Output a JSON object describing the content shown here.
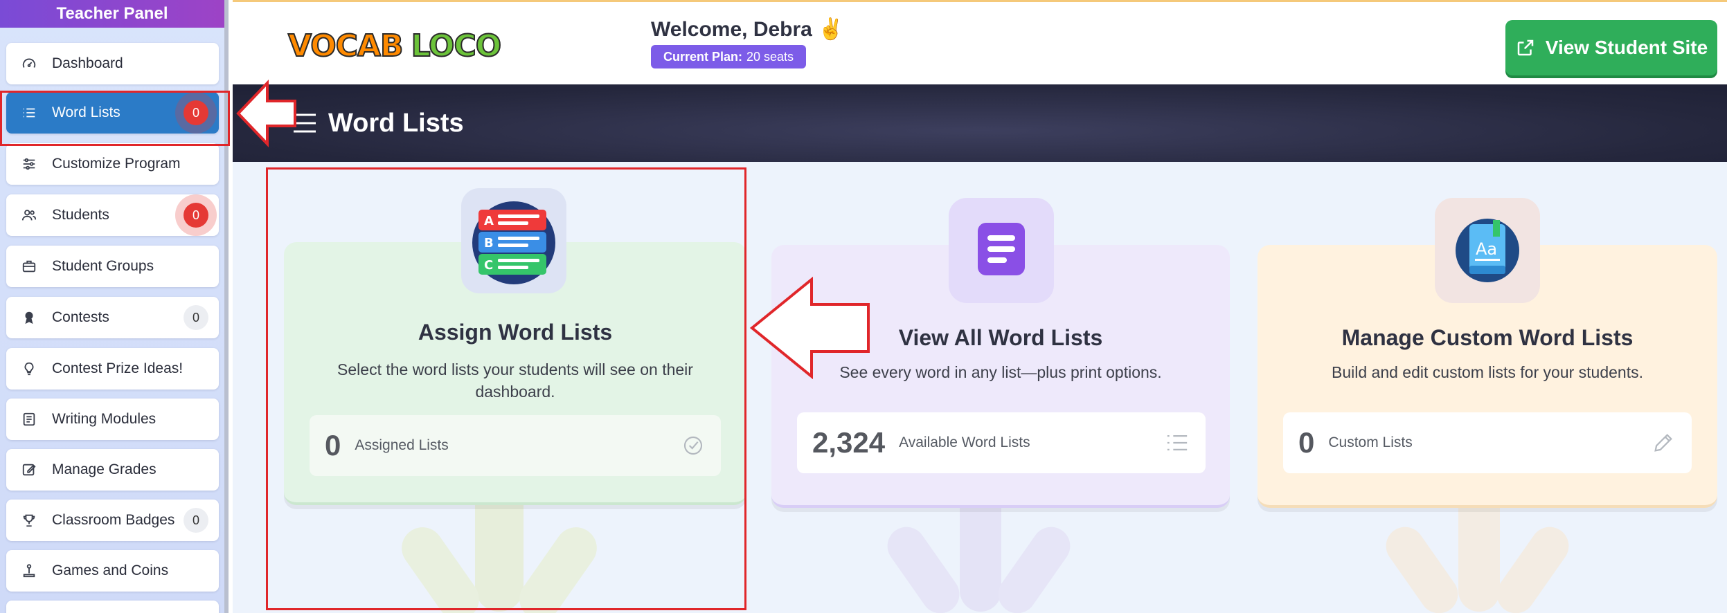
{
  "sidebar": {
    "header": "Teacher Panel",
    "items": [
      {
        "label": "Dashboard",
        "icon": "gauge-icon"
      },
      {
        "label": "Word Lists",
        "icon": "list-icon",
        "badge": "0",
        "badge_style": "red"
      },
      {
        "label": "Customize Program",
        "icon": "sliders-icon"
      },
      {
        "label": "Students",
        "icon": "users-icon",
        "badge": "0",
        "badge_style": "red"
      },
      {
        "label": "Student Groups",
        "icon": "briefcase-icon"
      },
      {
        "label": "Contests",
        "icon": "award-icon",
        "badge": "0",
        "badge_style": "grey"
      },
      {
        "label": "Contest Prize Ideas!",
        "icon": "lightbulb-icon"
      },
      {
        "label": "Writing Modules",
        "icon": "document-icon"
      },
      {
        "label": "Manage Grades",
        "icon": "edit-icon"
      },
      {
        "label": "Classroom Badges",
        "icon": "trophy-icon",
        "badge": "0",
        "badge_style": "grey"
      },
      {
        "label": "Games and Coins",
        "icon": "joystick-icon"
      }
    ]
  },
  "header": {
    "logo_word1": "VOCAB",
    "logo_word2": "LOCO",
    "welcome": "Welcome, Debra ✌️",
    "plan_label": "Current Plan:",
    "plan_value": "20 seats",
    "view_site_label": "View Student Site"
  },
  "page": {
    "title": "Word Lists"
  },
  "cards": [
    {
      "title": "Assign Word Lists",
      "description": "Select the word lists your students will see on their dashboard.",
      "stat_value": "0",
      "stat_label": "Assigned Lists",
      "stat_icon": "check-circle-icon"
    },
    {
      "title": "View All Word Lists",
      "description": "See every word in any list—plus print options.",
      "stat_value": "2,324",
      "stat_label": "Available Word Lists",
      "stat_icon": "list-icon"
    },
    {
      "title": "Manage Custom Word Lists",
      "description": "Build and edit custom lists for your students.",
      "stat_value": "0",
      "stat_label": "Custom Lists",
      "stat_icon": "pencil-icon"
    }
  ],
  "colors": {
    "sidebar_header": "#7a4bd6",
    "active_nav": "#2b7bc7",
    "badge_red": "#e53935",
    "plan_pill": "#7c5ce8",
    "view_site_button": "#2fae5a",
    "annotation": "#e0262a"
  }
}
